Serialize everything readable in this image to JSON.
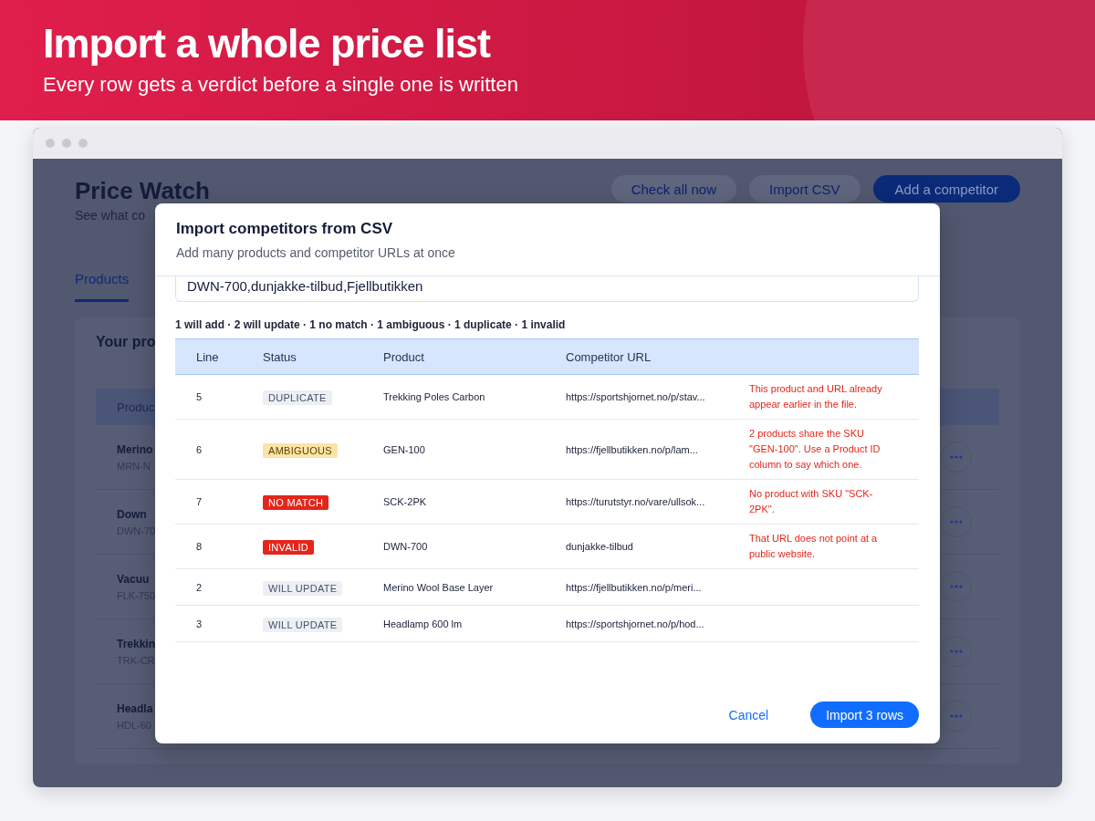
{
  "banner": {
    "title": "Import a whole price list",
    "subtitle": "Every row gets a verdict before a single one is written"
  },
  "app": {
    "title": "Price Watch",
    "subtitle": "See what co",
    "actions": [
      {
        "label": "Check all now",
        "kind": "secondary"
      },
      {
        "label": "Import CSV",
        "kind": "secondary"
      },
      {
        "label": "Add a competitor",
        "kind": "primary"
      }
    ],
    "tabs": [
      {
        "label": "Products",
        "selected": true
      }
    ],
    "card": {
      "title": "Your pro",
      "columns": [
        "Produc"
      ],
      "rows": [
        {
          "name": "Merino",
          "sku": "MRN-N"
        },
        {
          "name": "Down",
          "sku": "DWN-70"
        },
        {
          "name": "Vacuu",
          "sku": "FLK-750"
        },
        {
          "name": "Trekkin",
          "sku": "TRK-CR"
        },
        {
          "name": "Headla",
          "sku": "HDL-60"
        }
      ]
    }
  },
  "dialog": {
    "title": "Import competitors from CSV",
    "subtitle": "Add many products and competitor URLs at once",
    "csv_text": "DWN-700,dunjakke-tilbud,Fjellbutikken",
    "summary": "1 will add · 2 will update · 1 no match · 1 ambiguous · 1 duplicate · 1 invalid",
    "columns": [
      "Line",
      "Status",
      "Product",
      "Competitor URL"
    ],
    "rows": [
      {
        "line": "5",
        "status": {
          "label": "DUPLICATE",
          "kind": "duplicate"
        },
        "product": "Trekking Poles Carbon",
        "url": "https://sportshjornet.no/p/stav...",
        "message": "This product and URL already appear earlier in the file."
      },
      {
        "line": "6",
        "status": {
          "label": "AMBIGUOUS",
          "kind": "ambiguous"
        },
        "product": "GEN-100",
        "url": "https://fjellbutikken.no/p/lam...",
        "message": "2 products share the SKU \"GEN-100\". Use a Product ID column to say which one."
      },
      {
        "line": "7",
        "status": {
          "label": "NO MATCH",
          "kind": "error"
        },
        "product": "SCK-2PK",
        "url": "https://turutstyr.no/vare/ullsok...",
        "message": "No product with SKU \"SCK-2PK\"."
      },
      {
        "line": "8",
        "status": {
          "label": "INVALID",
          "kind": "error"
        },
        "product": "DWN-700",
        "url": "dunjakke-tilbud",
        "message": "That URL does not point at a public website."
      },
      {
        "line": "2",
        "status": {
          "label": "WILL UPDATE",
          "kind": "update"
        },
        "product": "Merino Wool Base Layer",
        "url": "https://fjellbutikken.no/p/meri..."
      },
      {
        "line": "3",
        "status": {
          "label": "WILL UPDATE",
          "kind": "update"
        },
        "product": "Headlamp 600 lm",
        "url": "https://sportshjornet.no/p/hod..."
      }
    ],
    "buttons": [
      {
        "label": "Cancel",
        "kind": "link"
      },
      {
        "label": "Import 3 rows",
        "kind": "primary"
      }
    ]
  }
}
